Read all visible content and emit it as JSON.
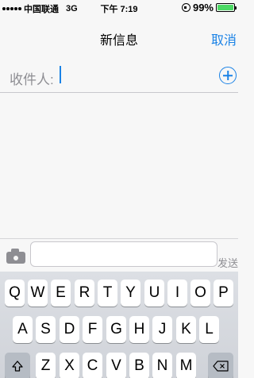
{
  "status_bar": {
    "carrier": "中国联通",
    "network": "3G",
    "time": "下午 7:19",
    "battery_percent": "99%",
    "battery_level": 0.99
  },
  "nav": {
    "title": "新信息",
    "cancel_label": "取消"
  },
  "recipient": {
    "label": "收件人:",
    "add_icon": "plus-circle-icon"
  },
  "compose": {
    "camera_icon": "camera-icon",
    "message_value": "",
    "send_label": "发送"
  },
  "keyboard": {
    "row1": [
      "Q",
      "W",
      "E",
      "R",
      "T",
      "Y",
      "U",
      "I",
      "O",
      "P"
    ],
    "row2": [
      "A",
      "S",
      "D",
      "F",
      "G",
      "H",
      "J",
      "K",
      "L"
    ],
    "row3": [
      "Z",
      "X",
      "C",
      "V",
      "B",
      "N",
      "M"
    ],
    "shift_icon": "shift-icon",
    "backspace_icon": "backspace-icon"
  },
  "colors": {
    "accent": "#1a82e6",
    "battery": "#4cd964"
  }
}
